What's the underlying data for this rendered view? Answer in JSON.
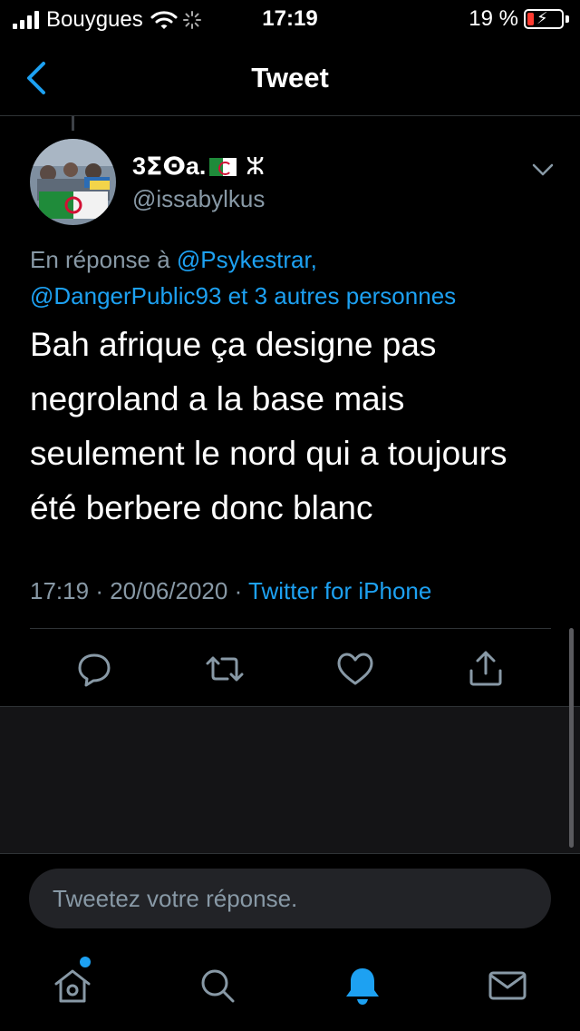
{
  "status_bar": {
    "carrier": "Bouygues",
    "time": "17:19",
    "battery_percent": "19 %",
    "battery_level": 0.19,
    "battery_color": "#ff3b30"
  },
  "nav": {
    "title": "Tweet",
    "back_icon": "chevron-left-icon"
  },
  "tweet": {
    "display_name": "3ⵉⵙa.",
    "name_symbol": "ⵣ",
    "flag": "algeria-flag",
    "handle": "@issabylkus",
    "reply_prefix": "En réponse à",
    "reply_mentions": [
      "@Psykestrar,",
      "@DangerPublic93"
    ],
    "reply_conjunction": "et",
    "reply_others": "3 autres personnes",
    "text": "Bah afrique ça designe pas negroland a la base mais seulement le nord qui a toujours été berbere donc blanc",
    "time": "17:19",
    "separator": "·",
    "date": "20/06/2020",
    "source": "Twitter for iPhone"
  },
  "actions": [
    "reply-icon",
    "retweet-icon",
    "like-icon",
    "share-icon"
  ],
  "reply_bar": {
    "placeholder": "Tweetez votre réponse."
  },
  "tabbar": {
    "items": [
      "home-icon",
      "search-icon",
      "notifications-icon",
      "messages-icon"
    ],
    "active": "notifications-icon",
    "accent": "#1da1f2"
  }
}
